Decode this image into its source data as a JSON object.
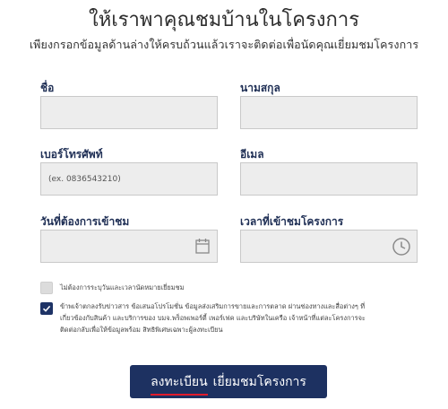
{
  "header": {
    "title": "ให้เราพาคุณชมบ้านในโครงการ",
    "subtitle": "เพียงกรอกข้อมูลด้านล่างให้ครบถ้วนแล้วเราจะติดต่อเพื่อนัดคุณเยี่ยมชมโครงการ"
  },
  "form": {
    "first_name": {
      "label": "ชื่อ",
      "value": ""
    },
    "last_name": {
      "label": "นามสกุล",
      "value": ""
    },
    "phone": {
      "label": "เบอร์โทรศัพท์",
      "placeholder": "(ex. 0836543210)"
    },
    "email": {
      "label": "อีเมล",
      "value": ""
    },
    "visit_date": {
      "label": "วันที่ต้องการเข้าชม",
      "icon": "calendar-icon"
    },
    "visit_time": {
      "label": "เวลาที่เข้าชมโครงการ",
      "icon": "clock-icon"
    }
  },
  "checkboxes": {
    "no_appointment": {
      "label": "ไม่ต้องการระบุวันและเวลานัดหมายเยี่ยมชม",
      "checked": false
    },
    "consent": {
      "lines": [
        "ข้าพเจ้าตกลงรับข่าวสาร ข้อเสนอโปรโมชั่น ข้อมูลส่งเสริมการขายและการตลาด ผ่านช่องทางและสื่อต่างๆ ที่",
        "เกี่ยวข้องกับสินค้า และบริการของ บมจ.พร็อพเพอร์ตี้ เพอร์เฟค และบริษัทในเครือ เจ้าหน้าที่แต่ละโครงการจะ",
        "ติดต่อกลับเพื่อให้ข้อมูลพร้อม สิทธิพิเศษเฉพาะผู้ลงทะเบียน"
      ],
      "checked": true
    }
  },
  "submit": {
    "part1": "ลงทะเบียน",
    "part2": "เยี่ยมชมโครงการ"
  },
  "colors": {
    "navy": "#1d3161",
    "field_bg": "#ededed",
    "underline_red": "#e01b2c"
  }
}
